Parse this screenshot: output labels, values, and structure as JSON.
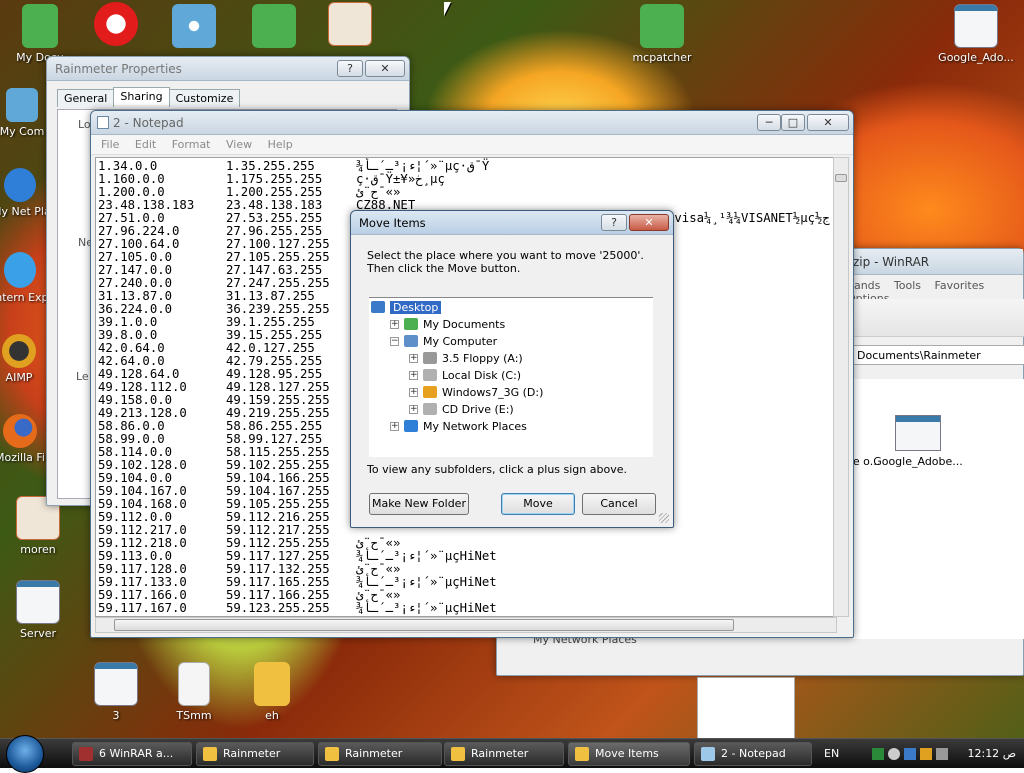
{
  "desktop": {
    "icons": [
      {
        "label": "My Docu",
        "color": "#4caf50"
      },
      {
        "label": "",
        "color": "#e21b1b"
      },
      {
        "label": "",
        "color": "#5fa8d8"
      },
      {
        "label": "",
        "color": "#4caf50"
      },
      {
        "label": "",
        "color": "#c96a3a"
      },
      {
        "label": "mcpatcher",
        "color": "#4caf50"
      },
      {
        "label": "Google_Ado...",
        "color": "#dde5ea"
      },
      {
        "label": "My Com",
        "color": "#5fa8d8"
      },
      {
        "label": "My Net Plac",
        "color": "#2f7fd8"
      },
      {
        "label": "Intern Explo",
        "color": "#3aa0e8"
      },
      {
        "label": "AIMP",
        "color": "#e0a020"
      },
      {
        "label": "Mozilla Fi",
        "color": "#e56a1a"
      },
      {
        "label": "moren",
        "color": "#c96a3a"
      },
      {
        "label": "Server",
        "color": "#dde5ea"
      },
      {
        "label": "3",
        "color": "#dde5ea"
      },
      {
        "label": "TSmm",
        "color": "#f5f5f5"
      },
      {
        "label": "eh",
        "color": "#f0c040"
      }
    ]
  },
  "rainmeter": {
    "title": "Rainmeter Properties",
    "tabs": [
      "General",
      "Sharing",
      "Customize"
    ],
    "fragments": [
      "Lo",
      "Ne",
      "Le"
    ]
  },
  "winrar": {
    "title_fragment": "zip - WinRAR",
    "menu": [
      "nands",
      "Tools",
      "Favorites",
      "Options"
    ],
    "path": "Documents\\Rainmeter",
    "files": [
      {
        "label": "ice  o..."
      },
      {
        "label": "Google_Adobe..."
      }
    ],
    "bottom_item": "My Network Places"
  },
  "notepad": {
    "title": "2 - Notepad",
    "menu": [
      "File",
      "Edit",
      "Format",
      "View",
      "Help"
    ],
    "rows": [
      [
        "1.34.0.0",
        "1.35.255.255",
        "¾ء¡³ـ´ـأ¦´»¨μç·ق¯Ÿ"
      ],
      [
        "1.160.0.0",
        "1.175.255.255",
        "ç·ق¯Ÿ±¥»خ¸μç"
      ],
      [
        "1.200.0.0",
        "1.200.255.255",
        "ح¨ئ¯«»"
      ],
      [
        "23.48.138.183",
        "23.48.138.183",
        "CZ88.NET"
      ],
      [
        "27.51.0.0",
        "27.53.255.255",
        "³μ¹ص¼ي¸¼¸ت˜خ×í¯Akamai°μ¹ص¼¾¸¼CDN½μç½ج×م٭·..visa¼¸¹¾¼VISANET½μç½ج"
      ],
      [
        "27.96.224.0",
        "27.96.255.255",
        ""
      ],
      [
        "27.100.64.0",
        "27.100.127.255",
        ""
      ],
      [
        "27.105.0.0",
        "27.105.255.255",
        ""
      ],
      [
        "27.147.0.0",
        "27.147.63.255",
        ""
      ],
      [
        "27.240.0.0",
        "27.247.255.255",
        ""
      ],
      [
        "31.13.87.0",
        "31.13.87.255",
        ""
      ],
      [
        "36.224.0.0",
        "36.239.255.255",
        ""
      ],
      [
        "39.1.0.0",
        "39.1.255.255",
        ""
      ],
      [
        "39.8.0.0",
        "39.15.255.255",
        ""
      ],
      [
        "42.0.64.0",
        "42.0.127.255",
        ""
      ],
      [
        "42.64.0.0",
        "42.79.255.255",
        ""
      ],
      [
        "49.128.64.0",
        "49.128.95.255",
        ""
      ],
      [
        "49.128.112.0",
        "49.128.127.255",
        ""
      ],
      [
        "49.158.0.0",
        "49.159.255.255",
        ""
      ],
      [
        "49.213.128.0",
        "49.219.255.255",
        ""
      ],
      [
        "58.86.0.0",
        "58.86.255.255",
        ""
      ],
      [
        "58.99.0.0",
        "58.99.127.255",
        ""
      ],
      [
        "58.114.0.0",
        "58.115.255.255",
        ""
      ],
      [
        "59.102.128.0",
        "59.102.255.255",
        ""
      ],
      [
        "59.104.0.0",
        "59.104.166.255",
        ""
      ],
      [
        "59.104.167.0",
        "59.104.167.255",
        ""
      ],
      [
        "59.104.168.0",
        "59.105.255.255",
        ""
      ],
      [
        "59.112.0.0",
        "59.112.216.255",
        ""
      ],
      [
        "59.112.217.0",
        "59.112.217.255",
        ""
      ],
      [
        "59.112.218.0",
        "59.112.255.255",
        "ح¨ئ¯«»"
      ],
      [
        "59.113.0.0",
        "59.117.127.255",
        "¾ء¡³ـ´ـأ¦´»¨μçHiNet"
      ],
      [
        "59.117.128.0",
        "59.117.132.255",
        "ح¨ئ¯«»"
      ],
      [
        "59.117.133.0",
        "59.117.165.255",
        "¾ء¡³ـ´ـأ¦´»¨μçHiNet"
      ],
      [
        "59.117.166.0",
        "59.117.166.255",
        "ح¨ئ¯«»"
      ],
      [
        "59.117.167.0",
        "59.123.255.255",
        "¾ء¡³ـ´ـأ¦´»¨μçHiNet"
      ]
    ]
  },
  "move_dialog": {
    "title": "Move Items",
    "instruction": "Select the place where you want to move '25000'. Then click the Move button.",
    "tree": [
      {
        "label": "Desktop",
        "indent": 0,
        "toggle": "",
        "selected": true,
        "icon_color": "#3a7ac8"
      },
      {
        "label": "My Documents",
        "indent": 1,
        "toggle": "+",
        "selected": false,
        "icon_color": "#4caf50"
      },
      {
        "label": "My Computer",
        "indent": 1,
        "toggle": "−",
        "selected": false,
        "icon_color": "#5f8fc8"
      },
      {
        "label": "3.5 Floppy (A:)",
        "indent": 2,
        "toggle": "+",
        "selected": false,
        "icon_color": "#999999"
      },
      {
        "label": "Local Disk (C:)",
        "indent": 2,
        "toggle": "+",
        "selected": false,
        "icon_color": "#b0b0b0"
      },
      {
        "label": "Windows7_3G (D:)",
        "indent": 2,
        "toggle": "+",
        "selected": false,
        "icon_color": "#e8a020"
      },
      {
        "label": "CD Drive (E:)",
        "indent": 2,
        "toggle": "+",
        "selected": false,
        "icon_color": "#b0b0b0"
      },
      {
        "label": "My Network Places",
        "indent": 1,
        "toggle": "+",
        "selected": false,
        "icon_color": "#2f7fd8"
      }
    ],
    "hint": "To view any subfolders, click a plus sign above.",
    "buttons": {
      "make_new_folder": "Make New Folder",
      "move": "Move",
      "cancel": "Cancel"
    },
    "help_glyph": "?",
    "close_glyph": "✕"
  },
  "taskbar": {
    "buttons": [
      {
        "label": "6 WinRAR a...",
        "color": "#a03030"
      },
      {
        "label": "Rainmeter",
        "color": "#f0c040"
      },
      {
        "label": "Rainmeter",
        "color": "#f0c040"
      },
      {
        "label": "Rainmeter",
        "color": "#f0c040"
      },
      {
        "label": "Move Items",
        "color": "#f0c040"
      },
      {
        "label": "2 - Notepad",
        "color": "#9ec8e8"
      }
    ],
    "language": "EN",
    "clock": "12:12 ص"
  }
}
